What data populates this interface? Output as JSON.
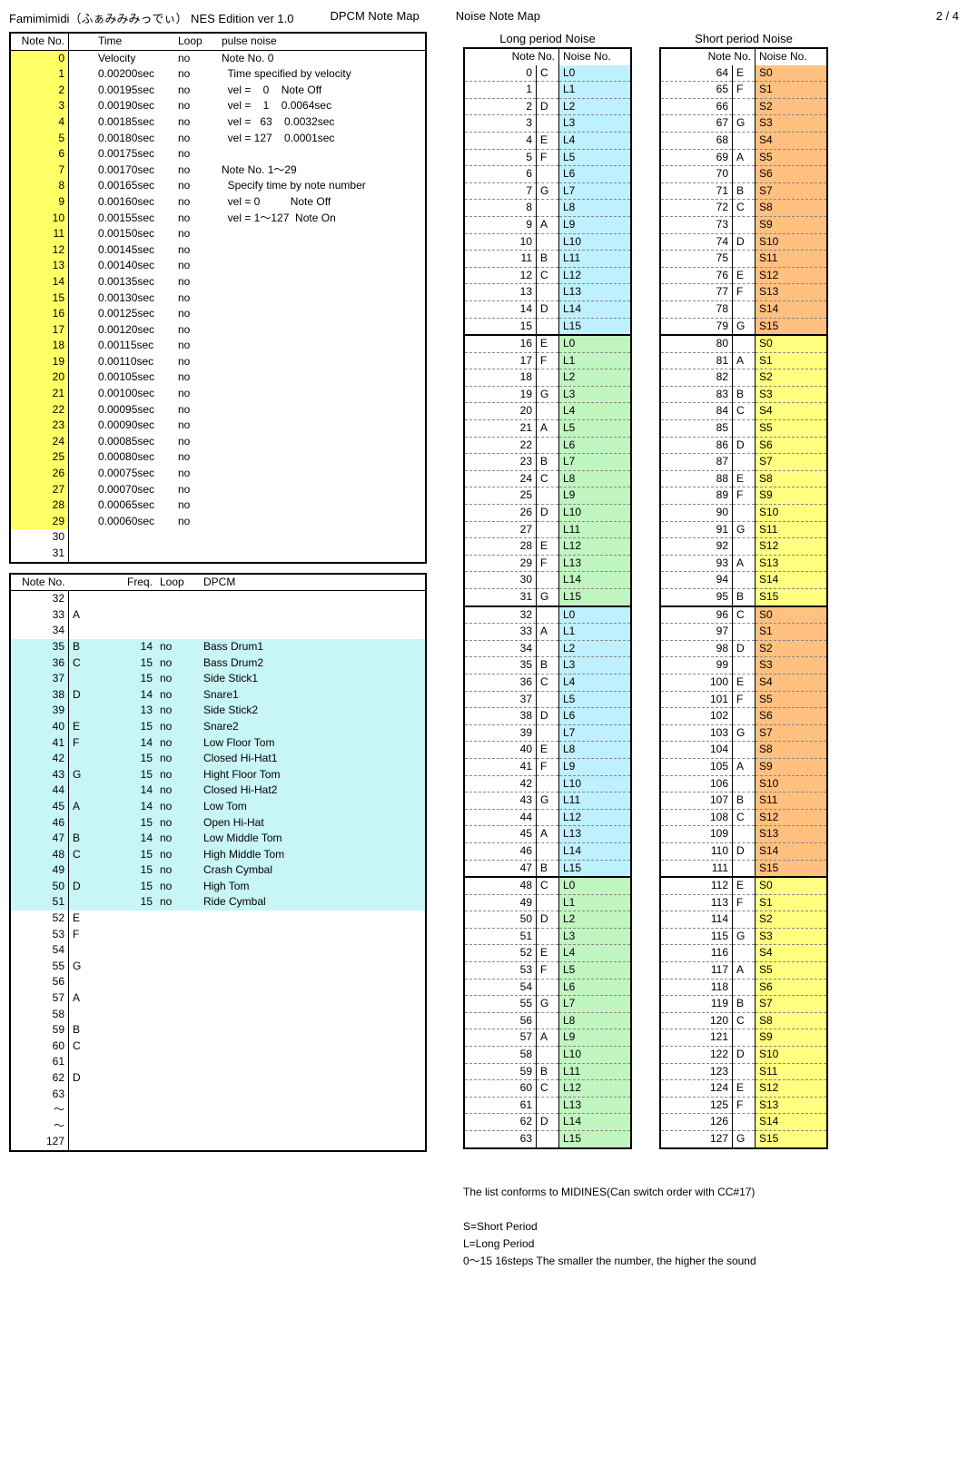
{
  "header": {
    "title": "Famimimidi（ふぁみみみっでぃ） NES Edition ver 1.0",
    "section1": "DPCM Note Map",
    "section2": "Noise Note Map",
    "page": "2 / 4"
  },
  "pulse_table": {
    "headers": {
      "note": "Note No.",
      "time": "Time",
      "loop": "Loop",
      "desc": "pulse noise"
    },
    "rows": [
      {
        "n": 0,
        "time": "Velocity",
        "loop": "no",
        "desc": "Note No. 0",
        "hl": true
      },
      {
        "n": 1,
        "time": "0.00200sec",
        "loop": "no",
        "desc": "  Time specified by velocity",
        "hl": true
      },
      {
        "n": 2,
        "time": "0.00195sec",
        "loop": "no",
        "desc": "  vel =    0    Note Off",
        "hl": true
      },
      {
        "n": 3,
        "time": "0.00190sec",
        "loop": "no",
        "desc": "  vel =    1    0.0064sec",
        "hl": true
      },
      {
        "n": 4,
        "time": "0.00185sec",
        "loop": "no",
        "desc": "  vel =   63    0.0032sec",
        "hl": true
      },
      {
        "n": 5,
        "time": "0.00180sec",
        "loop": "no",
        "desc": "  vel = 127    0.0001sec",
        "hl": true
      },
      {
        "n": 6,
        "time": "0.00175sec",
        "loop": "no",
        "desc": "",
        "hl": true
      },
      {
        "n": 7,
        "time": "0.00170sec",
        "loop": "no",
        "desc": "Note No. 1～29",
        "hl": true
      },
      {
        "n": 8,
        "time": "0.00165sec",
        "loop": "no",
        "desc": "  Specify time by note number",
        "hl": true
      },
      {
        "n": 9,
        "time": "0.00160sec",
        "loop": "no",
        "desc": "  vel = 0          Note Off",
        "hl": true
      },
      {
        "n": 10,
        "time": "0.00155sec",
        "loop": "no",
        "desc": "  vel = 1～127  Note On",
        "hl": true
      },
      {
        "n": 11,
        "time": "0.00150sec",
        "loop": "no",
        "desc": "",
        "hl": true
      },
      {
        "n": 12,
        "time": "0.00145sec",
        "loop": "no",
        "desc": "",
        "hl": true
      },
      {
        "n": 13,
        "time": "0.00140sec",
        "loop": "no",
        "desc": "",
        "hl": true
      },
      {
        "n": 14,
        "time": "0.00135sec",
        "loop": "no",
        "desc": "",
        "hl": true
      },
      {
        "n": 15,
        "time": "0.00130sec",
        "loop": "no",
        "desc": "",
        "hl": true
      },
      {
        "n": 16,
        "time": "0.00125sec",
        "loop": "no",
        "desc": "",
        "hl": true
      },
      {
        "n": 17,
        "time": "0.00120sec",
        "loop": "no",
        "desc": "",
        "hl": true
      },
      {
        "n": 18,
        "time": "0.00115sec",
        "loop": "no",
        "desc": "",
        "hl": true
      },
      {
        "n": 19,
        "time": "0.00110sec",
        "loop": "no",
        "desc": "",
        "hl": true
      },
      {
        "n": 20,
        "time": "0.00105sec",
        "loop": "no",
        "desc": "",
        "hl": true
      },
      {
        "n": 21,
        "time": "0.00100sec",
        "loop": "no",
        "desc": "",
        "hl": true
      },
      {
        "n": 22,
        "time": "0.00095sec",
        "loop": "no",
        "desc": "",
        "hl": true
      },
      {
        "n": 23,
        "time": "0.00090sec",
        "loop": "no",
        "desc": "",
        "hl": true
      },
      {
        "n": 24,
        "time": "0.00085sec",
        "loop": "no",
        "desc": "",
        "hl": true
      },
      {
        "n": 25,
        "time": "0.00080sec",
        "loop": "no",
        "desc": "",
        "hl": true
      },
      {
        "n": 26,
        "time": "0.00075sec",
        "loop": "no",
        "desc": "",
        "hl": true
      },
      {
        "n": 27,
        "time": "0.00070sec",
        "loop": "no",
        "desc": "",
        "hl": true
      },
      {
        "n": 28,
        "time": "0.00065sec",
        "loop": "no",
        "desc": "",
        "hl": true
      },
      {
        "n": 29,
        "time": "0.00060sec",
        "loop": "no",
        "desc": "",
        "hl": true
      },
      {
        "n": 30,
        "time": "",
        "loop": "",
        "desc": "",
        "hl": false
      },
      {
        "n": 31,
        "time": "",
        "loop": "",
        "desc": "",
        "hl": false
      }
    ]
  },
  "dpcm_table": {
    "headers": {
      "note": "Note No.",
      "freq": "Freq.",
      "loop": "Loop",
      "dpcm": "DPCM"
    },
    "rows": [
      {
        "n": 32,
        "l": "",
        "f": "",
        "loop": "",
        "d": "",
        "hl": false
      },
      {
        "n": 33,
        "l": "A",
        "f": "",
        "loop": "",
        "d": "",
        "hl": false
      },
      {
        "n": 34,
        "l": "",
        "f": "",
        "loop": "",
        "d": "",
        "hl": false
      },
      {
        "n": 35,
        "l": "B",
        "f": "14",
        "loop": "no",
        "d": "Bass Drum1",
        "hl": true
      },
      {
        "n": 36,
        "l": "C",
        "f": "15",
        "loop": "no",
        "d": "Bass Drum2",
        "hl": true
      },
      {
        "n": 37,
        "l": "",
        "f": "15",
        "loop": "no",
        "d": "Side Stick1",
        "hl": true
      },
      {
        "n": 38,
        "l": "D",
        "f": "14",
        "loop": "no",
        "d": "Snare1",
        "hl": true
      },
      {
        "n": 39,
        "l": "",
        "f": "13",
        "loop": "no",
        "d": "Side Stick2",
        "hl": true
      },
      {
        "n": 40,
        "l": "E",
        "f": "15",
        "loop": "no",
        "d": "Snare2",
        "hl": true
      },
      {
        "n": 41,
        "l": "F",
        "f": "14",
        "loop": "no",
        "d": "Low Floor Tom",
        "hl": true
      },
      {
        "n": 42,
        "l": "",
        "f": "15",
        "loop": "no",
        "d": "Closed Hi-Hat1",
        "hl": true
      },
      {
        "n": 43,
        "l": "G",
        "f": "15",
        "loop": "no",
        "d": "Hight Floor Tom",
        "hl": true
      },
      {
        "n": 44,
        "l": "",
        "f": "14",
        "loop": "no",
        "d": "Closed Hi-Hat2",
        "hl": true
      },
      {
        "n": 45,
        "l": "A",
        "f": "14",
        "loop": "no",
        "d": "Low Tom",
        "hl": true
      },
      {
        "n": 46,
        "l": "",
        "f": "15",
        "loop": "no",
        "d": "Open Hi-Hat",
        "hl": true
      },
      {
        "n": 47,
        "l": "B",
        "f": "14",
        "loop": "no",
        "d": "Low Middle Tom",
        "hl": true
      },
      {
        "n": 48,
        "l": "C",
        "f": "15",
        "loop": "no",
        "d": "High Middle Tom",
        "hl": true
      },
      {
        "n": 49,
        "l": "",
        "f": "15",
        "loop": "no",
        "d": "Crash Cymbal",
        "hl": true
      },
      {
        "n": 50,
        "l": "D",
        "f": "15",
        "loop": "no",
        "d": "High Tom",
        "hl": true
      },
      {
        "n": 51,
        "l": "",
        "f": "15",
        "loop": "no",
        "d": "Ride Cymbal",
        "hl": true
      },
      {
        "n": 52,
        "l": "E",
        "f": "",
        "loop": "",
        "d": "",
        "hl": false
      },
      {
        "n": 53,
        "l": "F",
        "f": "",
        "loop": "",
        "d": "",
        "hl": false
      },
      {
        "n": 54,
        "l": "",
        "f": "",
        "loop": "",
        "d": "",
        "hl": false
      },
      {
        "n": 55,
        "l": "G",
        "f": "",
        "loop": "",
        "d": "",
        "hl": false
      },
      {
        "n": 56,
        "l": "",
        "f": "",
        "loop": "",
        "d": "",
        "hl": false
      },
      {
        "n": 57,
        "l": "A",
        "f": "",
        "loop": "",
        "d": "",
        "hl": false
      },
      {
        "n": 58,
        "l": "",
        "f": "",
        "loop": "",
        "d": "",
        "hl": false
      },
      {
        "n": 59,
        "l": "B",
        "f": "",
        "loop": "",
        "d": "",
        "hl": false
      },
      {
        "n": 60,
        "l": "C",
        "f": "",
        "loop": "",
        "d": "",
        "hl": false
      },
      {
        "n": 61,
        "l": "",
        "f": "",
        "loop": "",
        "d": "",
        "hl": false
      },
      {
        "n": 62,
        "l": "D",
        "f": "",
        "loop": "",
        "d": "",
        "hl": false
      },
      {
        "n": 63,
        "l": "",
        "f": "",
        "loop": "",
        "d": "",
        "hl": false
      },
      {
        "n": "～",
        "l": "",
        "f": "",
        "loop": "",
        "d": "",
        "hl": false
      },
      {
        "n": "～",
        "l": "",
        "f": "",
        "loop": "",
        "d": "",
        "hl": false
      },
      {
        "n": 127,
        "l": "",
        "f": "",
        "loop": "",
        "d": "",
        "hl": false
      }
    ]
  },
  "long_noise": {
    "title": "Long period Noise",
    "headers": {
      "nn": "Note No.",
      "noise": "Noise No."
    },
    "letters": [
      "C",
      "",
      "D",
      "",
      "E",
      "F",
      "",
      "G",
      "",
      "A",
      "",
      "B"
    ],
    "label_prefix": "L",
    "start": 0,
    "end": 63,
    "colors": [
      "blue",
      "green",
      "blue",
      "green"
    ]
  },
  "short_noise": {
    "title": "Short period Noise",
    "headers": {
      "nn": "Note No.",
      "noise": "Noise No."
    },
    "letters_start_at": 64,
    "letters": [
      "E",
      "F",
      "",
      "G",
      "",
      "A",
      "",
      "B",
      "C",
      "",
      "D",
      ""
    ],
    "label_prefix": "S",
    "start": 64,
    "end": 127,
    "colors": [
      "orange",
      "yelw",
      "orange",
      "yelw"
    ]
  },
  "chromatic_letters": [
    "C",
    "",
    "D",
    "",
    "E",
    "F",
    "",
    "G",
    "",
    "A",
    "",
    "B"
  ],
  "footer": {
    "line1": "The list conforms to MIDINES(Can switch order with CC#17)",
    "line2": "S=Short Period",
    "line3": "L=Long Period",
    "line4": "0～15 16steps     The smaller the number, the higher the sound"
  }
}
